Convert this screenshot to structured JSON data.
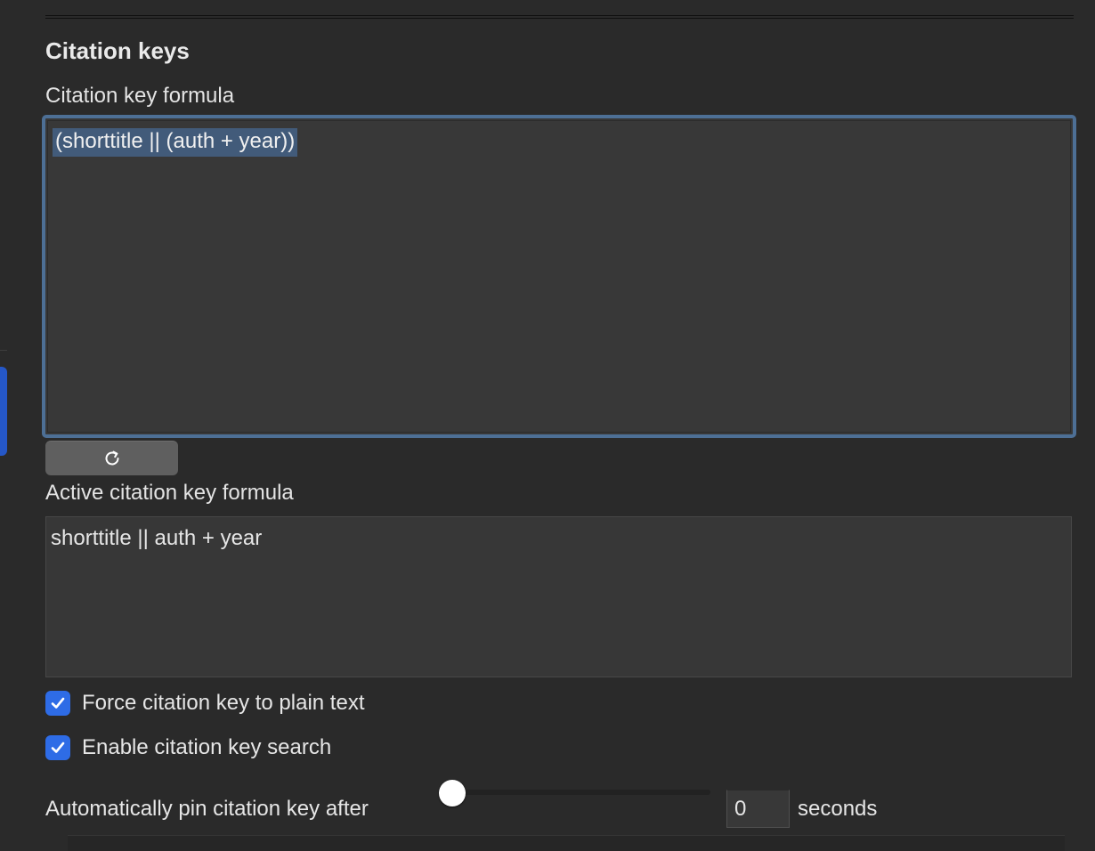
{
  "section": {
    "title": "Citation keys"
  },
  "formula": {
    "label": "Citation key formula",
    "value": "(shorttitle || (auth + year))"
  },
  "refresh_button": {
    "icon": "refresh-icon"
  },
  "active_formula": {
    "label": "Active citation key formula",
    "value": "shorttitle || auth + year"
  },
  "options": {
    "force_plain_text": {
      "label": "Force citation key to plain text",
      "checked": true
    },
    "enable_search": {
      "label": "Enable citation key search",
      "checked": true
    }
  },
  "autopin": {
    "label": "Automatically pin citation key after",
    "value": "0",
    "slider_fraction": 0,
    "unit": "seconds"
  },
  "colors": {
    "accent": "#2e6ce6",
    "focus_ring": "#4d6f95",
    "selection": "#425b7a",
    "background": "#2a2a2a"
  }
}
